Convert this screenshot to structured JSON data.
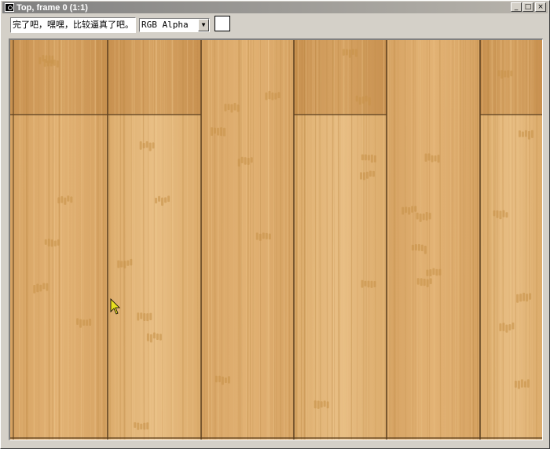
{
  "window": {
    "title": "Top, frame 0 (1:1)",
    "buttons": [
      "_",
      "□",
      "×"
    ]
  },
  "toolbar": {
    "status_text": "完了吧，嘿嘿，比较逼真了吧。",
    "channel_value": "RGB Alpha",
    "swatch_color": "#ffffff"
  },
  "viewport": {
    "content": "bamboo-floor-texture",
    "colors": {
      "plank_light": "#e2b274",
      "plank_mid": "#d6a363",
      "plank_dark": "#c89150",
      "seam": "#5a3e1e"
    }
  }
}
